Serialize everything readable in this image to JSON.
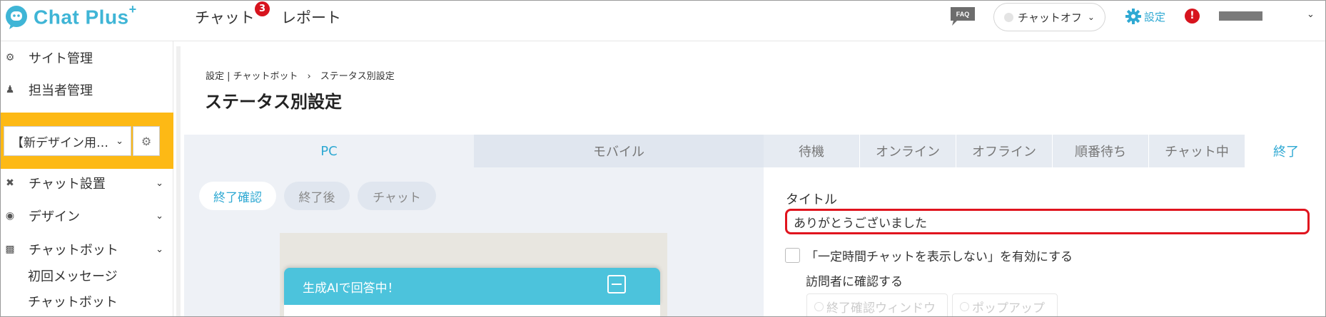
{
  "header": {
    "logo_text": "Chat Plus",
    "logo_sup": "+",
    "nav": {
      "chat": "チャット",
      "chat_badge": "3",
      "report": "レポート"
    },
    "faq_label": "FAQ",
    "status_select": "チャットオフ",
    "settings_label": "設定",
    "alert_mark": "!"
  },
  "sidebar": {
    "site_admin": "サイト管理",
    "staff_admin": "担当者管理",
    "site_select": "【新デザイン用…",
    "chat_setup": "チャット設置",
    "design": "デザイン",
    "chatbot": "チャットボット",
    "sub_first_message": "初回メッセージ",
    "sub_chatbot": "チャットボット"
  },
  "main": {
    "breadcrumb": "設定 | チャットボット　›　ステータス別設定",
    "title": "ステータス別設定",
    "device_tabs": {
      "pc": "PC",
      "mobile": "モバイル"
    },
    "status_tabs": [
      "待機",
      "オンライン",
      "オフライン",
      "順番待ち",
      "チャット中",
      "終了"
    ],
    "pills": [
      "終了確認",
      "終了後",
      "チャット"
    ],
    "chat_header_title": "生成AIで回答中！",
    "form": {
      "title_label": "タイトル",
      "title_value": "ありがとうございました",
      "check_hide": "「一定時間チャットを表示しない」を有効にする",
      "check_confirm": "訪問者に確認する",
      "radio_window": "終了確認ウィンドウ",
      "radio_popup": "ポップアップ"
    }
  },
  "colors": {
    "accent": "#2fa9d3",
    "highlight": "#fdb915",
    "alert": "#d7141e",
    "chat_header": "#4cc3dc"
  }
}
